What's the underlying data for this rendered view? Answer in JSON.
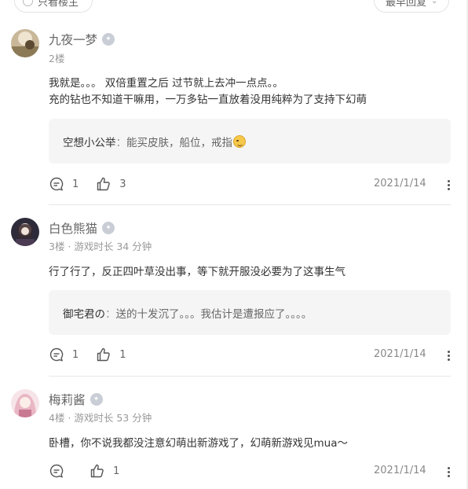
{
  "filters": {
    "left_label": "只看楼主",
    "right_label": "最早回复"
  },
  "comments": [
    {
      "username": "九夜一梦",
      "meta": "2楼",
      "body_lines": [
        "我就是。。。   双倍重置之后 过节就上去冲一点点。。",
        "充的钻也不知道干嘛用，一万多钻一直放着没用纯粹为了支持下幻萌"
      ],
      "reply": {
        "name": "空想小公举",
        "sep": "：",
        "text": "能买皮肤，船位，戒指"
      },
      "reply_count": "1",
      "like_count": "3",
      "date": "2021/1/14"
    },
    {
      "username": "白色熊猫",
      "meta": "3楼 · 游戏时长 34 分钟",
      "body_lines": [
        "行了行了，反正四叶草没出事，等下就开服没必要为了这事生气"
      ],
      "reply": {
        "name": "御宅君の",
        "sep": "：",
        "text": "送的十发沉了。。。我估计是遭报应了。。。。"
      },
      "reply_count": "1",
      "like_count": "1",
      "date": "2021/1/14"
    },
    {
      "username": "梅莉酱",
      "meta": "4楼 · 游戏时长 53 分钟",
      "body_lines": [
        "卧槽，你不说我都没注意幻萌出新游戏了，幻萌新游戏见mua～"
      ],
      "reply_count": "",
      "like_count": "1",
      "date": "2021/1/14"
    }
  ],
  "icons": {
    "comment": "comment-bubble-icon",
    "like": "thumbs-up-icon",
    "more": "more-vertical-icon",
    "badge": "level-badge-icon"
  },
  "colors": {
    "reply_bg": "#f5f5f6",
    "meta_text": "#999999",
    "badge": "#c9ced6"
  }
}
